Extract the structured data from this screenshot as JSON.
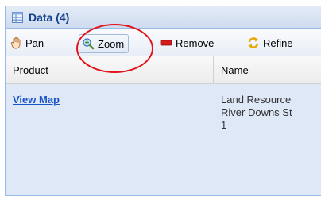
{
  "panel": {
    "title": "Data (4)",
    "icon": "grid-table-icon"
  },
  "toolbar": {
    "pan_label": "Pan",
    "pan_icon": "hand-icon",
    "zoom_label": "Zoom",
    "zoom_icon": "magnifier-icon",
    "remove_label": "Remove",
    "remove_icon": "minus-icon",
    "refine_label": "Refine",
    "refine_icon": "refresh-icon"
  },
  "grid": {
    "columns": [
      "Product",
      "Name"
    ],
    "rows": [
      {
        "product": "View Map",
        "name_lines": [
          "Land Resource",
          "River Downs St",
          "1"
        ]
      }
    ]
  },
  "colors": {
    "header_title": "#15428b",
    "link": "#1a55c8",
    "highlight": "#e0141b",
    "row_bg": "#dfe8f6"
  }
}
